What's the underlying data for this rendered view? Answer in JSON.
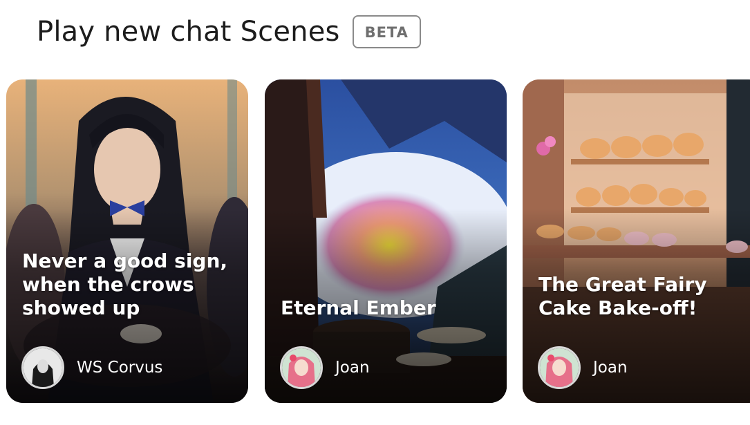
{
  "header": {
    "title": "Play new chat Scenes",
    "badge": "BETA"
  },
  "cards": [
    {
      "title": "Never a good sign, when the crows showed up",
      "author": "WS Corvus"
    },
    {
      "title": "Eternal Ember",
      "author": "Joan"
    },
    {
      "title": "The Great Fairy Cake Bake-off!",
      "author": "Joan"
    }
  ]
}
